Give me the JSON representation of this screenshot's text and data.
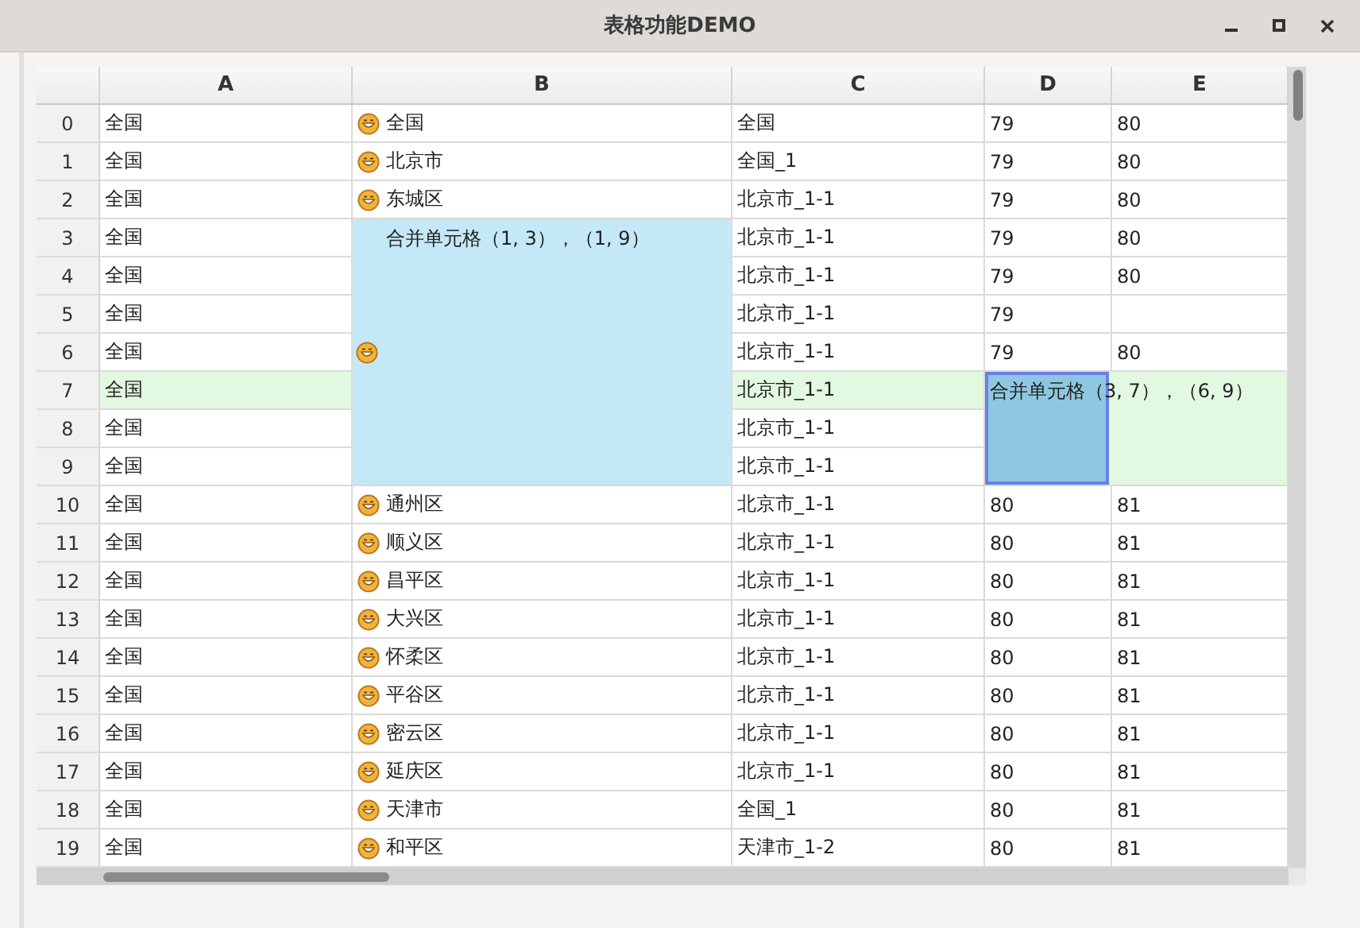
{
  "window": {
    "title": "表格功能DEMO"
  },
  "table": {
    "columns": [
      "A",
      "B",
      "C",
      "D",
      "E"
    ],
    "rows": [
      {
        "header": "0",
        "highlighted": false,
        "cells": [
          {
            "kind": "text",
            "text": "全国"
          },
          {
            "kind": "icon_text",
            "text": "全国"
          },
          {
            "kind": "text",
            "text": "全国"
          },
          {
            "kind": "text",
            "text": "79"
          },
          {
            "kind": "text",
            "text": "80"
          }
        ]
      },
      {
        "header": "1",
        "highlighted": false,
        "cells": [
          {
            "kind": "text",
            "text": "全国"
          },
          {
            "kind": "icon_text",
            "text": "北京市"
          },
          {
            "kind": "text",
            "text": "全国_1"
          },
          {
            "kind": "text",
            "text": "79"
          },
          {
            "kind": "text",
            "text": "80"
          }
        ]
      },
      {
        "header": "2",
        "highlighted": false,
        "cells": [
          {
            "kind": "text",
            "text": "全国"
          },
          {
            "kind": "icon_text",
            "text": "东城区"
          },
          {
            "kind": "text",
            "text": "北京市_1-1"
          },
          {
            "kind": "text",
            "text": "79"
          },
          {
            "kind": "text",
            "text": "80"
          }
        ]
      },
      {
        "header": "3",
        "highlighted": false,
        "cells": [
          {
            "kind": "text",
            "text": "全国"
          },
          {
            "kind": "merged",
            "text": "合并单元格（1, 3），（1, 9）",
            "icon": true,
            "selected": false
          },
          {
            "kind": "text",
            "text": "北京市_1-1"
          },
          {
            "kind": "text",
            "text": "79"
          },
          {
            "kind": "text",
            "text": "80"
          }
        ]
      },
      {
        "header": "4",
        "highlighted": false,
        "cells": [
          {
            "kind": "text",
            "text": "全国"
          },
          {
            "kind": "covered"
          },
          {
            "kind": "text",
            "text": "北京市_1-1"
          },
          {
            "kind": "text",
            "text": "79"
          },
          {
            "kind": "text",
            "text": "80"
          }
        ]
      },
      {
        "header": "5",
        "highlighted": false,
        "cells": [
          {
            "kind": "text",
            "text": "全国"
          },
          {
            "kind": "covered"
          },
          {
            "kind": "text",
            "text": "北京市_1-1"
          },
          {
            "kind": "text",
            "text": "79"
          },
          {
            "kind": "blank"
          }
        ]
      },
      {
        "header": "6",
        "highlighted": false,
        "cells": [
          {
            "kind": "text",
            "text": "全国"
          },
          {
            "kind": "covered"
          },
          {
            "kind": "text",
            "text": "北京市_1-1"
          },
          {
            "kind": "text",
            "text": "79"
          },
          {
            "kind": "text",
            "text": "80"
          }
        ]
      },
      {
        "header": "7",
        "highlighted": true,
        "cells": [
          {
            "kind": "text",
            "text": "全国"
          },
          {
            "kind": "covered"
          },
          {
            "kind": "text",
            "text": "北京市_1-1"
          },
          {
            "kind": "merged",
            "text": "合并单元格（3, 7），（6, 9）",
            "icon": false,
            "selected": true
          },
          {
            "kind": "covered"
          }
        ]
      },
      {
        "header": "8",
        "highlighted": false,
        "cells": [
          {
            "kind": "text",
            "text": "全国"
          },
          {
            "kind": "covered"
          },
          {
            "kind": "text",
            "text": "北京市_1-1"
          },
          {
            "kind": "covered"
          },
          {
            "kind": "covered"
          }
        ]
      },
      {
        "header": "9",
        "highlighted": false,
        "cells": [
          {
            "kind": "text",
            "text": "全国"
          },
          {
            "kind": "covered"
          },
          {
            "kind": "text",
            "text": "北京市_1-1"
          },
          {
            "kind": "covered"
          },
          {
            "kind": "covered"
          }
        ]
      },
      {
        "header": "10",
        "highlighted": false,
        "cells": [
          {
            "kind": "text",
            "text": "全国"
          },
          {
            "kind": "icon_text",
            "text": "通州区"
          },
          {
            "kind": "text",
            "text": "北京市_1-1"
          },
          {
            "kind": "text",
            "text": "80"
          },
          {
            "kind": "text",
            "text": "81"
          }
        ]
      },
      {
        "header": "11",
        "highlighted": false,
        "cells": [
          {
            "kind": "text",
            "text": "全国"
          },
          {
            "kind": "icon_text",
            "text": "顺义区"
          },
          {
            "kind": "text",
            "text": "北京市_1-1"
          },
          {
            "kind": "text",
            "text": "80"
          },
          {
            "kind": "text",
            "text": "81"
          }
        ]
      },
      {
        "header": "12",
        "highlighted": false,
        "cells": [
          {
            "kind": "text",
            "text": "全国"
          },
          {
            "kind": "icon_text",
            "text": "昌平区"
          },
          {
            "kind": "text",
            "text": "北京市_1-1"
          },
          {
            "kind": "text",
            "text": "80"
          },
          {
            "kind": "text",
            "text": "81"
          }
        ]
      },
      {
        "header": "13",
        "highlighted": false,
        "cells": [
          {
            "kind": "text",
            "text": "全国"
          },
          {
            "kind": "icon_text",
            "text": "大兴区"
          },
          {
            "kind": "text",
            "text": "北京市_1-1"
          },
          {
            "kind": "text",
            "text": "80"
          },
          {
            "kind": "text",
            "text": "81"
          }
        ]
      },
      {
        "header": "14",
        "highlighted": false,
        "cells": [
          {
            "kind": "text",
            "text": "全国"
          },
          {
            "kind": "icon_text",
            "text": "怀柔区"
          },
          {
            "kind": "text",
            "text": "北京市_1-1"
          },
          {
            "kind": "text",
            "text": "80"
          },
          {
            "kind": "text",
            "text": "81"
          }
        ]
      },
      {
        "header": "15",
        "highlighted": false,
        "cells": [
          {
            "kind": "text",
            "text": "全国"
          },
          {
            "kind": "icon_text",
            "text": "平谷区"
          },
          {
            "kind": "text",
            "text": "北京市_1-1"
          },
          {
            "kind": "text",
            "text": "80"
          },
          {
            "kind": "text",
            "text": "81"
          }
        ]
      },
      {
        "header": "16",
        "highlighted": false,
        "cells": [
          {
            "kind": "text",
            "text": "全国"
          },
          {
            "kind": "icon_text",
            "text": "密云区"
          },
          {
            "kind": "text",
            "text": "北京市_1-1"
          },
          {
            "kind": "text",
            "text": "80"
          },
          {
            "kind": "text",
            "text": "81"
          }
        ]
      },
      {
        "header": "17",
        "highlighted": false,
        "cells": [
          {
            "kind": "text",
            "text": "全国"
          },
          {
            "kind": "icon_text",
            "text": "延庆区"
          },
          {
            "kind": "text",
            "text": "北京市_1-1"
          },
          {
            "kind": "text",
            "text": "80"
          },
          {
            "kind": "text",
            "text": "81"
          }
        ]
      },
      {
        "header": "18",
        "highlighted": false,
        "cells": [
          {
            "kind": "text",
            "text": "全国"
          },
          {
            "kind": "icon_text",
            "text": "天津市"
          },
          {
            "kind": "text",
            "text": "全国_1"
          },
          {
            "kind": "text",
            "text": "80"
          },
          {
            "kind": "text",
            "text": "81"
          }
        ]
      },
      {
        "header": "19",
        "highlighted": false,
        "cells": [
          {
            "kind": "text",
            "text": "全国"
          },
          {
            "kind": "icon_text",
            "text": "和平区"
          },
          {
            "kind": "text",
            "text": "天津市_1-2"
          },
          {
            "kind": "text",
            "text": "80"
          },
          {
            "kind": "text",
            "text": "81"
          }
        ]
      }
    ]
  }
}
